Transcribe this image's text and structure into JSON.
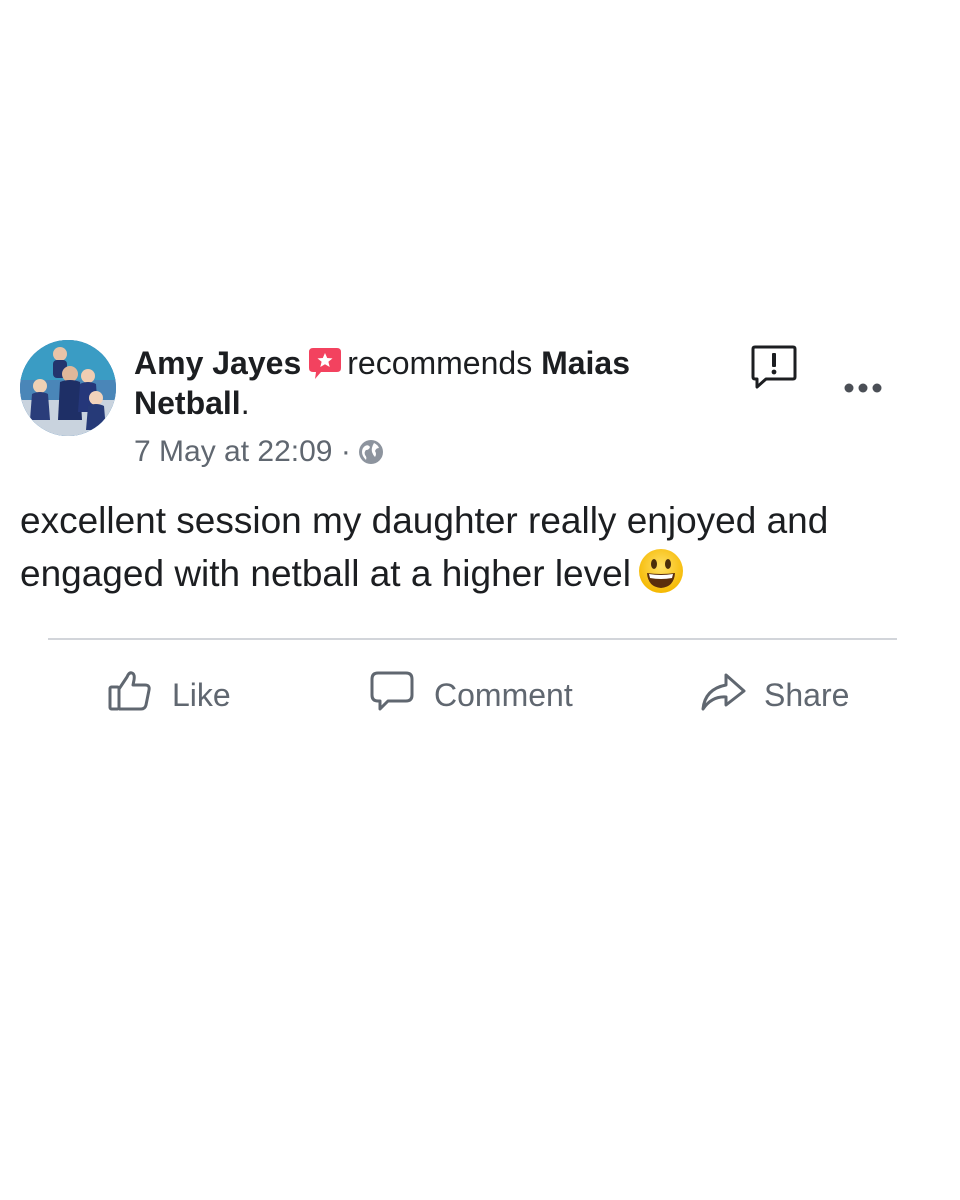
{
  "post": {
    "author": "Amy Jayes",
    "recommends_text": "recommends",
    "page_name": "Maias Netball",
    "page_name_suffix": ".",
    "timestamp": "7 May at 22:09",
    "separator": "·",
    "body": "excellent session my daughter really enjoyed and engaged with netball at a higher level",
    "emoji": "grinning-face-emoji"
  },
  "actions": {
    "like_label": "Like",
    "comment_label": "Comment",
    "share_label": "Share"
  },
  "icons": {
    "recommend": "recommend-star-icon",
    "privacy": "globe-icon",
    "report": "report-icon",
    "more": "more-options-icon"
  },
  "colors": {
    "recommend_red": "#f3425f",
    "text_primary": "#1c1e21",
    "text_secondary": "#606770",
    "divider": "#d2d5da"
  }
}
